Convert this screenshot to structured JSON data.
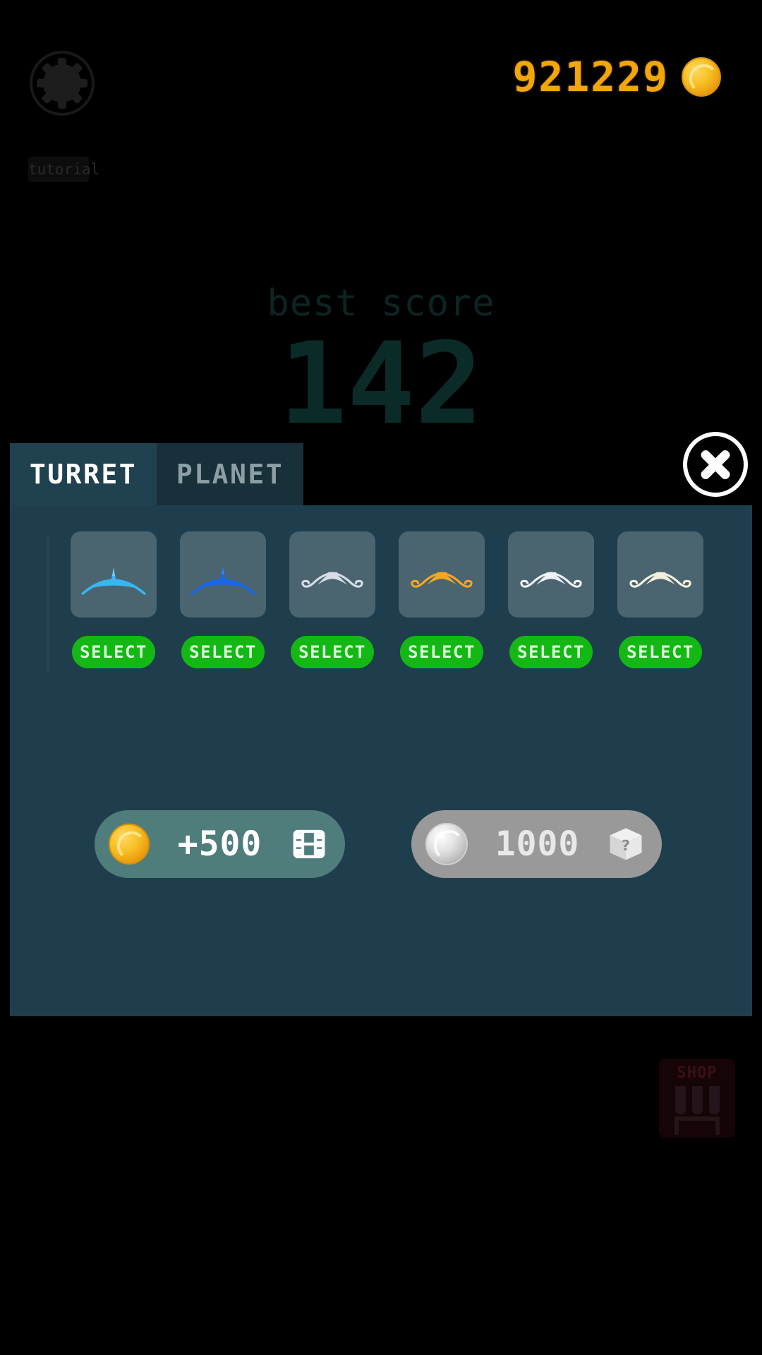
{
  "hud": {
    "settings_icon": "gear-icon",
    "tutorial_label": "tutorial",
    "coins": "921229",
    "coin_icon": "gold-coin-icon"
  },
  "background": {
    "best_score_label": "best score",
    "best_score_value": "142",
    "shop_label": "SHOP",
    "shop_icon": "storefront-icon"
  },
  "modal": {
    "close_icon": "close-x-icon",
    "tabs": [
      {
        "label": "TURRET",
        "active": true
      },
      {
        "label": "PLANET",
        "active": false
      }
    ],
    "items": [
      {
        "name": "turret-cyan",
        "color": "#39b5f0",
        "shape": "winged-arc",
        "button": "SELECT"
      },
      {
        "name": "turret-blue",
        "color": "#1668e8",
        "shape": "winged-arc",
        "button": "SELECT"
      },
      {
        "name": "turret-silver",
        "color": "#d7dce6",
        "shape": "curled-wing",
        "button": "SELECT"
      },
      {
        "name": "turret-orange",
        "color": "#f5a623",
        "shape": "curled-wing",
        "button": "SELECT"
      },
      {
        "name": "turret-white",
        "color": "#eef2f6",
        "shape": "curled-wing",
        "button": "SELECT"
      },
      {
        "name": "turret-cream",
        "color": "#f2f0dc",
        "shape": "curled-wing",
        "button": "SELECT"
      }
    ],
    "rewards": [
      {
        "name": "watch-ad-for-coins",
        "currency_icon": "gold-coin-icon",
        "value": "+500",
        "action_icon": "video-film-icon",
        "color": "#4f7d7b"
      },
      {
        "name": "buy-mystery-box",
        "currency_icon": "silver-coin-icon",
        "value": "1000",
        "action_icon": "mystery-box-icon",
        "color": "#999999"
      }
    ]
  },
  "colors": {
    "panel": "#1f3e4d",
    "tab_active": "#20414f",
    "tab_inactive": "#17303a",
    "tile": "#4a6470",
    "select_green": "#14b814",
    "coin_gold": "#f2a60c"
  }
}
